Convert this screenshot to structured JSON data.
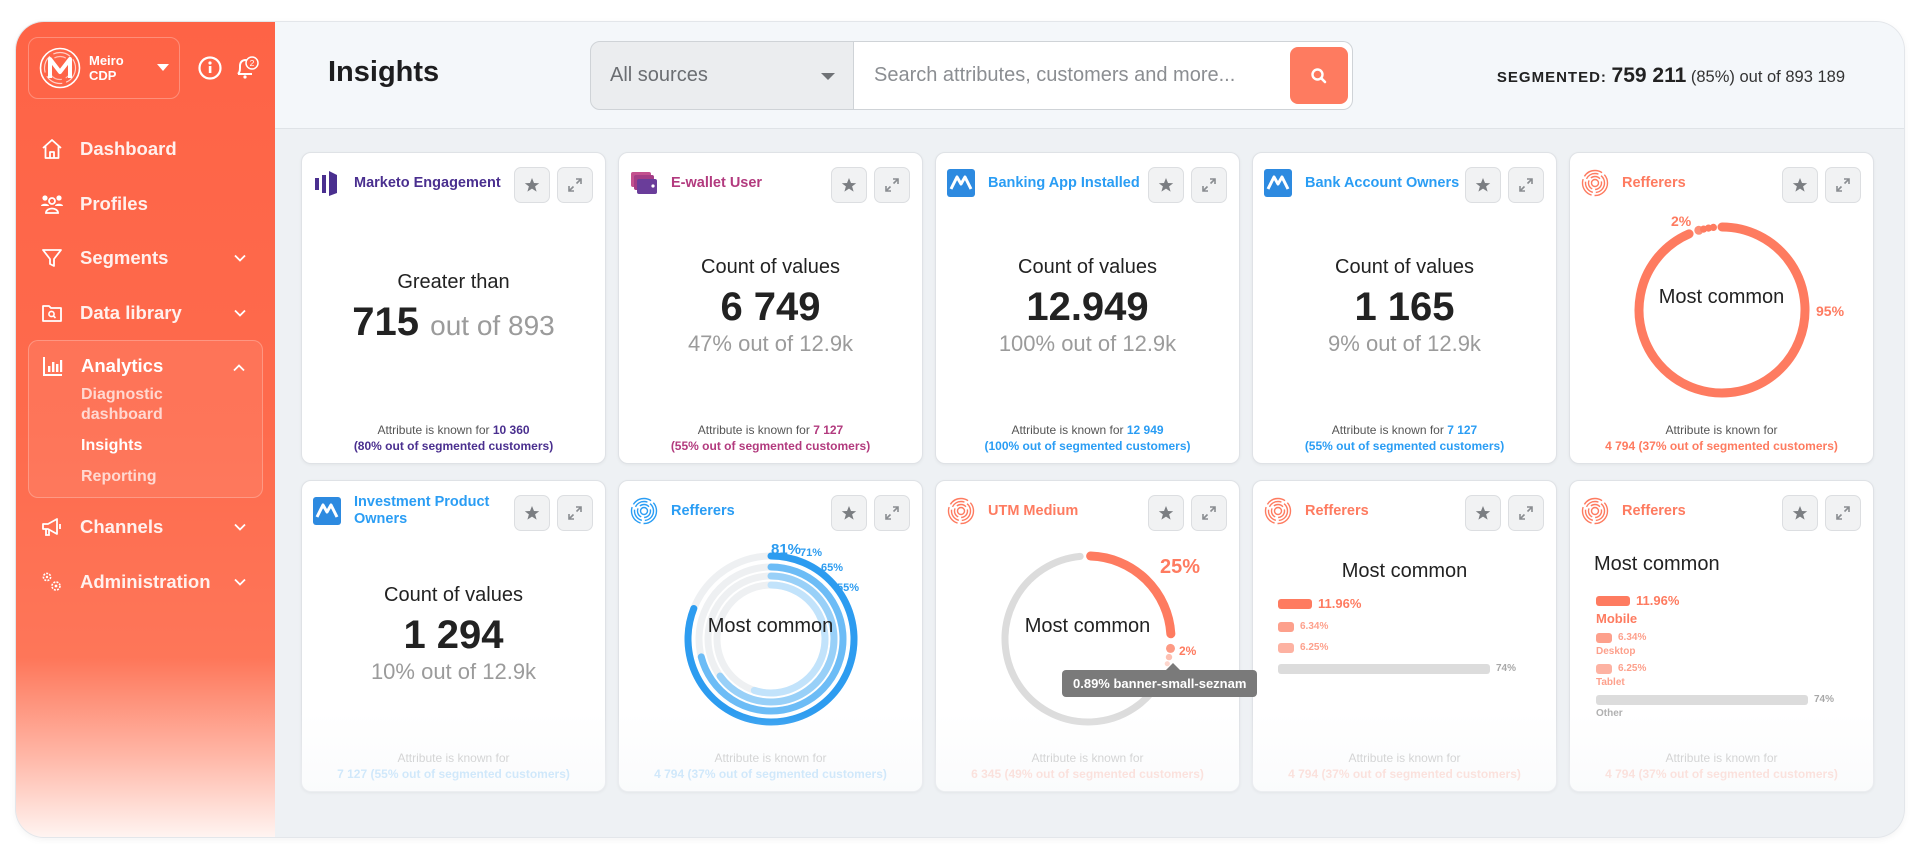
{
  "app": {
    "brand_name_line1": "Meiro",
    "brand_name_line2": "CDP",
    "notification_count": "2",
    "accent_color": "#fe6346"
  },
  "sidebar": {
    "items": [
      {
        "label": "Dashboard",
        "icon": "home-icon"
      },
      {
        "label": "Profiles",
        "icon": "users-icon"
      },
      {
        "label": "Segments",
        "icon": "filter-icon",
        "has_chevron": true
      },
      {
        "label": "Data library",
        "icon": "folder-search-icon",
        "has_chevron": true
      },
      {
        "label": "Analytics",
        "icon": "bar-chart-icon",
        "expanded": true,
        "children": [
          {
            "label": "Diagnostic dashboard"
          },
          {
            "label": "Insights",
            "active": true
          },
          {
            "label": "Reporting"
          }
        ]
      },
      {
        "label": "Channels",
        "icon": "megaphone-icon",
        "has_chevron": true
      },
      {
        "label": "Administration",
        "icon": "gears-icon",
        "has_chevron": true
      }
    ]
  },
  "header": {
    "title": "Insights",
    "source_select": {
      "selected": "All sources"
    },
    "search": {
      "placeholder": "Search attributes, customers and more...",
      "value": ""
    },
    "segmented": {
      "label": "SEGMENTED:",
      "count": "759 211",
      "rest": "(85%) out of 893 189"
    }
  },
  "cards": [
    {
      "title": "Marketo Engagement",
      "color": "#4a2f8f",
      "icon": "marketo-icon",
      "type": "greater",
      "label": "Greater than",
      "value": "715",
      "out_of": "out of 893",
      "foot_text": "Attribute is known for",
      "foot_count": "10 360",
      "foot_pct": "(80% out of segmented customers)"
    },
    {
      "title": "E-wallet User",
      "color": "#b23a7e",
      "icon": "wallet-icon",
      "type": "count",
      "label": "Count of values",
      "value": "6 749",
      "sub": "47% out of 12.9k",
      "foot_text": "Attribute is known for",
      "foot_count": "7 127",
      "foot_pct": "(55% out of segmented customers)"
    },
    {
      "title": "Banking App Installed",
      "color": "#2a9df4",
      "icon": "banking-app-icon",
      "type": "count",
      "label": "Count of values",
      "value": "12.949",
      "sub": "100% out of 12.9k",
      "foot_text": "Attribute is known for",
      "foot_count": "12 949",
      "foot_pct": "(100% out of segmented customers)"
    },
    {
      "title": "Bank Account Owners",
      "color": "#2a9df4",
      "icon": "banking-app-icon",
      "type": "count",
      "label": "Count of values",
      "value": "1 165",
      "sub": "9% out of 12.9k",
      "foot_text": "Attribute is known for",
      "foot_count": "7 127",
      "foot_pct": "(55% out of segmented customers)"
    },
    {
      "title": "Refferers",
      "color": "#fe7b60",
      "icon": "maze-circle-icon",
      "type": "donut",
      "center": "Most common",
      "primary_pct": 95,
      "small_pct_label": "2%",
      "primary_pct_label": "95%",
      "foot_text": "Attribute is known for",
      "foot_line2": "4 794 (37% out of segmented customers)"
    },
    {
      "title": "Investment Product Owners",
      "color": "#2a9df4",
      "icon": "banking-app-icon",
      "type": "count",
      "label": "Count of values",
      "value": "1 294",
      "sub": "10% out of 12.9k",
      "foot_text": "Attribute is known for",
      "foot_line2": "7 127 (55% out of segmented customers)"
    },
    {
      "title": "Refferers",
      "color": "#2a9df4",
      "icon": "maze-circle-icon",
      "type": "radial",
      "center": "Most common",
      "rings": [
        {
          "pct": 81,
          "label": "81%"
        },
        {
          "pct": 71,
          "label": "71%"
        },
        {
          "pct": 65,
          "label": "65%"
        },
        {
          "pct": 55,
          "label": "55%"
        }
      ],
      "foot_text": "Attribute is known for",
      "foot_line2": "4 794 (37% out of segmented customers)"
    },
    {
      "title": "UTM Medium",
      "color": "#fe7b60",
      "icon": "maze-circle-icon",
      "type": "donut2",
      "center": "Most common",
      "primary_pct": 25,
      "primary_pct_label": "25%",
      "small_pct_label": "2%",
      "tooltip": "0.89% banner-small-seznam",
      "foot_text": "Attribute is known for",
      "foot_line2": "6 345 (49% out of segmented customers)"
    },
    {
      "title": "Refferers",
      "color": "#fe7b60",
      "icon": "maze-circle-icon",
      "type": "bars",
      "heading": "Most common",
      "bars": [
        {
          "pct": 11.96,
          "label": "11.96%"
        },
        {
          "pct": 6.34,
          "label": "6.34%"
        },
        {
          "pct": 6.25,
          "label": "6.25%"
        },
        {
          "pct": 74,
          "label": "74%",
          "other": true
        }
      ],
      "foot_text": "Attribute is known for",
      "foot_line2": "4 794 (37% out of segmented customers)"
    },
    {
      "title": "Refferers",
      "color": "#fe7b60",
      "icon": "maze-circle-icon",
      "type": "bars-named",
      "heading": "Most common",
      "bars": [
        {
          "pct": 11.96,
          "label": "11.96%",
          "name": "Mobile"
        },
        {
          "pct": 6.34,
          "label": "6.34%",
          "name": "Desktop"
        },
        {
          "pct": 6.25,
          "label": "6.25%",
          "name": "Tablet"
        },
        {
          "pct": 74,
          "label": "74%",
          "name": "Other",
          "other": true
        }
      ],
      "foot_text": "Attribute is known for",
      "foot_line2": "4 794 (37% out of segmented customers)"
    }
  ]
}
